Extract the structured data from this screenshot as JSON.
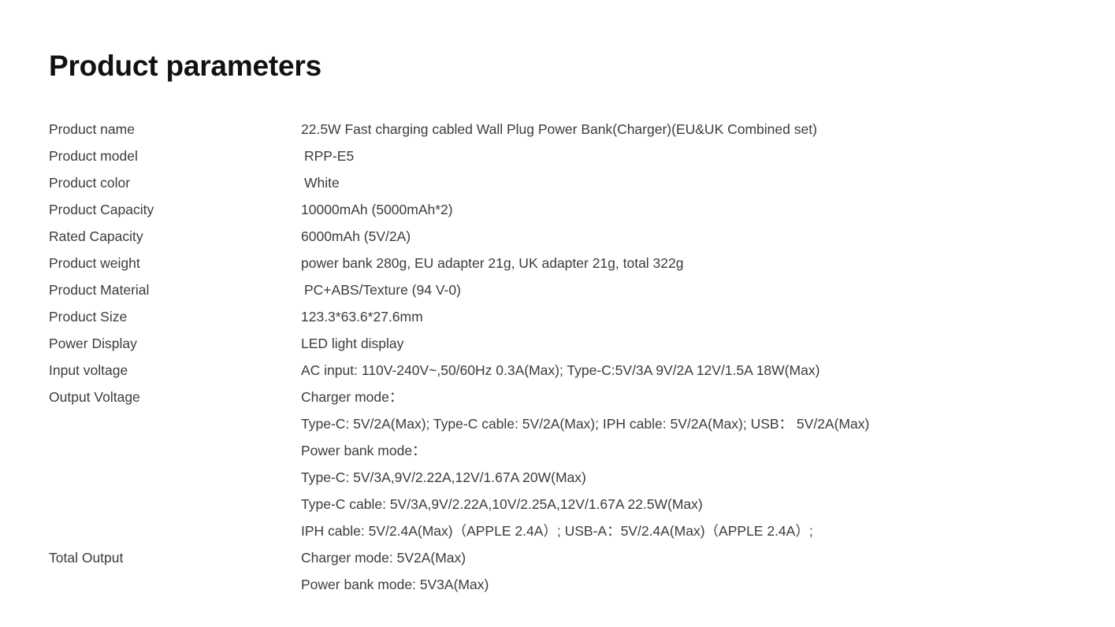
{
  "document": {
    "title": "Product parameters"
  },
  "specs": [
    {
      "label": "Product name",
      "value": "22.5W Fast charging cabled Wall Plug Power Bank(Charger)(EU&UK Combined set)",
      "indented": false
    },
    {
      "label": "Product model",
      "value": "RPP-E5",
      "indented": true
    },
    {
      "label": "Product color",
      "value": "White",
      "indented": true
    },
    {
      "label": "Product Capacity",
      "value": "10000mAh (5000mAh*2)",
      "indented": false
    },
    {
      "label": "Rated Capacity",
      "value": "6000mAh (5V/2A)",
      "indented": false
    },
    {
      "label": "Product weight",
      "value": "power bank 280g, EU adapter 21g, UK adapter 21g, total 322g",
      "indented": false
    },
    {
      "label": "Product Material",
      "value": "PC+ABS/Texture (94 V-0)",
      "indented": false
    },
    {
      "label": "Product Size",
      "value": "123.3*63.6*27.6mm",
      "indented": false
    },
    {
      "label": "Power Display",
      "value": "LED light display",
      "indented": false
    },
    {
      "label": "Input voltage",
      "value": "AC input: 110V-240V~,50/60Hz 0.3A(Max); Type-C:5V/3A 9V/2A 12V/1.5A 18W(Max)",
      "indented": false
    }
  ],
  "output_voltage": {
    "label": "Output Voltage",
    "lines": [
      "Charger mode：",
      "Type-C: 5V/2A(Max); Type-C cable: 5V/2A(Max); IPH cable: 5V/2A(Max); USB：  5V/2A(Max)",
      "Power bank mode：",
      "Type-C: 5V/3A,9V/2.22A,12V/1.67A 20W(Max)",
      "Type-C cable: 5V/3A,9V/2.22A,10V/2.25A,12V/1.67A 22.5W(Max)",
      "IPH cable: 5V/2.4A(Max)（APPLE 2.4A）; USB-A：5V/2.4A(Max)（APPLE 2.4A）;"
    ]
  },
  "total_output": {
    "label": "Total Output",
    "lines": [
      "Charger mode: 5V2A(Max)",
      "Power bank mode: 5V3A(Max)"
    ]
  }
}
